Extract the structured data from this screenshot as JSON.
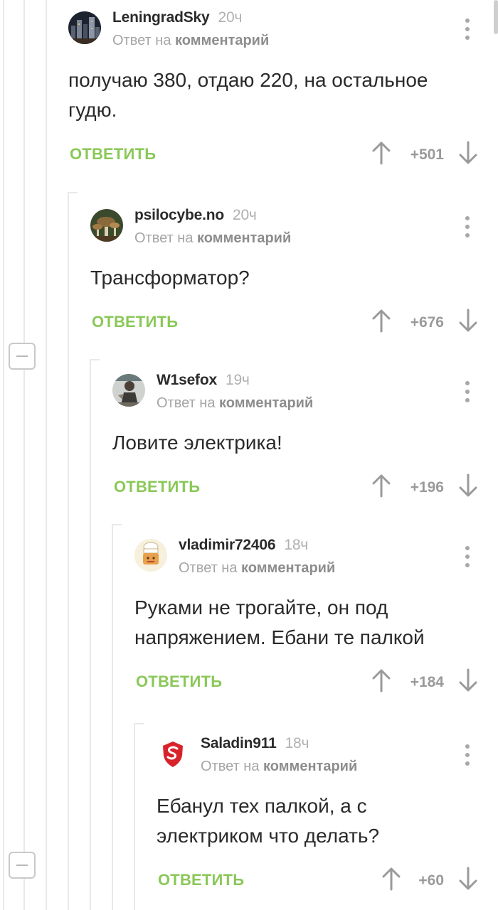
{
  "thread": {
    "reply_prefix": "Ответ на",
    "reply_target": "комментарий",
    "reply_button_label": "ОТВЕТИТЬ",
    "colors": {
      "accent_green": "#8ac858",
      "muted_gray": "#a5a5a5"
    }
  },
  "comments": [
    {
      "username": "LeningradSky",
      "time": "20ч",
      "text": "получаю 380, отдаю 220, на остальное гудю.",
      "score": "+501",
      "avatar": "night-city-avatar"
    },
    {
      "username": "psilocybe.no",
      "time": "20ч",
      "text": "Трансформатор?",
      "score": "+676",
      "avatar": "mushrooms-avatar"
    },
    {
      "username": "W1sefox",
      "time": "19ч",
      "text": "Ловите электрика!",
      "score": "+196",
      "avatar": "figure-avatar"
    },
    {
      "username": "vladimir72406",
      "time": "18ч",
      "text": "Руками не трогайте, он под напряжением. Ебани те палкой",
      "score": "+184",
      "avatar": "chef-cartoon-avatar"
    },
    {
      "username": "Saladin911",
      "time": "18ч",
      "text": "Ебанул тех палкой, а с электриком что делать?",
      "score": "+60",
      "avatar": "red-shield-avatar"
    }
  ]
}
